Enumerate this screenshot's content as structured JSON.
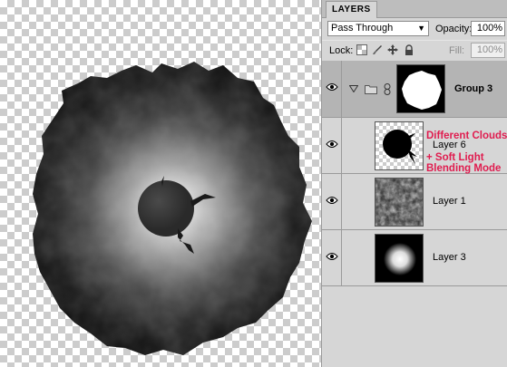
{
  "panel": {
    "tab_label": "LAYERS",
    "blend_mode": "Pass Through",
    "opacity_label": "Opacity:",
    "opacity_value": "100%",
    "lock_label": "Lock:",
    "fill_label": "Fill:",
    "fill_value": "100%"
  },
  "layers": [
    {
      "name": "Group 3",
      "type": "group",
      "visible": true
    },
    {
      "name": "Layer 6",
      "type": "layer",
      "visible": true
    },
    {
      "name": "Layer 1",
      "type": "layer",
      "visible": true
    },
    {
      "name": "Layer 3",
      "type": "layer",
      "visible": true
    }
  ],
  "annotation": {
    "lines": [
      "Different Clouds",
      "+ Soft Light",
      "Blending Mode"
    ],
    "color": "#e01c4f"
  },
  "icons": [
    "eye-icon",
    "disclosure-triangle-icon",
    "folder-icon",
    "chain-link-icon",
    "lock-transparent-icon",
    "lock-brush-icon",
    "lock-move-icon",
    "lock-all-icon",
    "dropdown-arrow-icon"
  ]
}
